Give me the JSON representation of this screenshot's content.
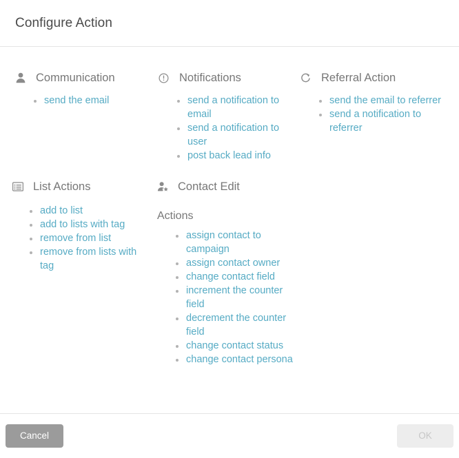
{
  "dialog": {
    "title": "Configure Action"
  },
  "groups": [
    {
      "id": "communication",
      "title": "Communication",
      "icon": "user-icon",
      "items": [
        {
          "label": "send the email"
        }
      ]
    },
    {
      "id": "notifications",
      "title": "Notifications",
      "icon": "exclamation-circle-icon",
      "items": [
        {
          "label": "send a notification to email"
        },
        {
          "label": "send a notification to user"
        },
        {
          "label": "post back lead info"
        }
      ]
    },
    {
      "id": "referral-action",
      "title": "Referral Action",
      "icon": "refresh-icon",
      "items": [
        {
          "label": "send the email to referrer"
        },
        {
          "label": "send a notification to referrer"
        }
      ]
    },
    {
      "id": "list-actions",
      "title": "List Actions",
      "icon": "list-alt-icon",
      "items": [
        {
          "label": "add to list"
        },
        {
          "label": "add to lists with tag"
        },
        {
          "label": "remove from list"
        },
        {
          "label": "remove from lists with tag"
        }
      ]
    },
    {
      "id": "contact-edit",
      "title": "Contact Edit",
      "icon": "user-star-icon",
      "subheading": "Actions",
      "items": [
        {
          "label": "assign contact to campaign"
        },
        {
          "label": "assign contact owner"
        },
        {
          "label": "change contact field"
        },
        {
          "label": "increment the counter field"
        },
        {
          "label": "decrement the counter field"
        },
        {
          "label": "change contact status"
        },
        {
          "label": "change contact persona"
        }
      ]
    }
  ],
  "footer": {
    "cancel_label": "Cancel",
    "ok_label": "OK"
  },
  "colors": {
    "link": "#56abc4",
    "heading": "#777777",
    "title": "#4a4a4a",
    "cancel_bg": "#9b9b9b",
    "ok_bg": "#ededed"
  }
}
